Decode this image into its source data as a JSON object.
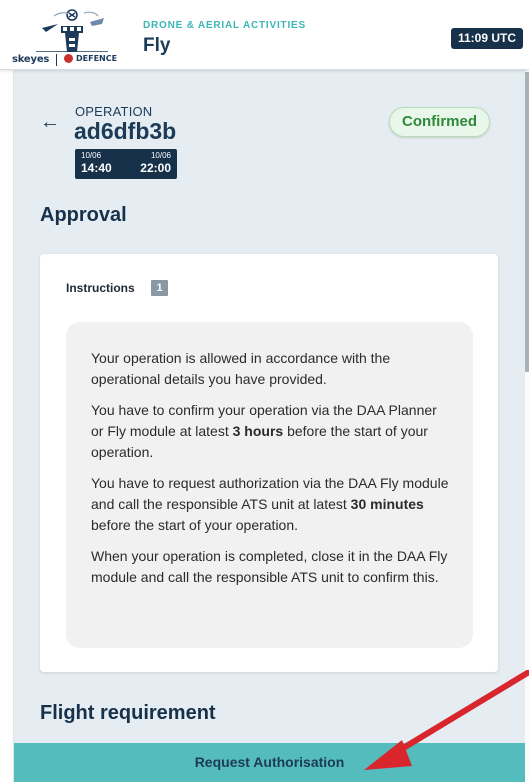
{
  "header": {
    "logo_text": "skeyes",
    "logo_partner": "DEFENCE",
    "subtitle": "DRONE & AERIAL ACTIVITIES",
    "title": "Fly",
    "clock": "11:09 UTC"
  },
  "operation": {
    "label": "OPERATION",
    "id": "ad6dfb3b",
    "start_date": "10/06",
    "start_time": "14:40",
    "end_date": "10/06",
    "end_time": "22:00",
    "status": "Confirmed"
  },
  "approval": {
    "title": "Approval",
    "instructions_label": "Instructions",
    "instructions_count": "1",
    "paragraphs": [
      {
        "text": "Your operation is allowed in accordance with the operational details you have provided."
      },
      {
        "before": "You have to confirm your operation via the DAA Planner or Fly module at latest ",
        "bold": "3 hours",
        "after": " before the start of your operation."
      },
      {
        "before": "You have to request authorization via the DAA Fly module and call the responsible ATS unit at latest ",
        "bold": "30 minutes",
        "after": " before the start of your operation."
      },
      {
        "text": "When your operation is completed, close it in the DAA Fly module and call the responsible ATS unit to confirm this."
      }
    ]
  },
  "flight_requirement": {
    "title": "Flight requirement"
  },
  "action": {
    "request_label": "Request Authorisation"
  },
  "colors": {
    "accent": "#55bcbd",
    "navy": "#17314a",
    "confirmed": "#2e8a3a",
    "annotation_arrow": "#d9262c"
  },
  "icons": {
    "back": "arrow-left-icon",
    "logo": "control-tower-icon",
    "annotation": "red-arrow-annotation"
  }
}
